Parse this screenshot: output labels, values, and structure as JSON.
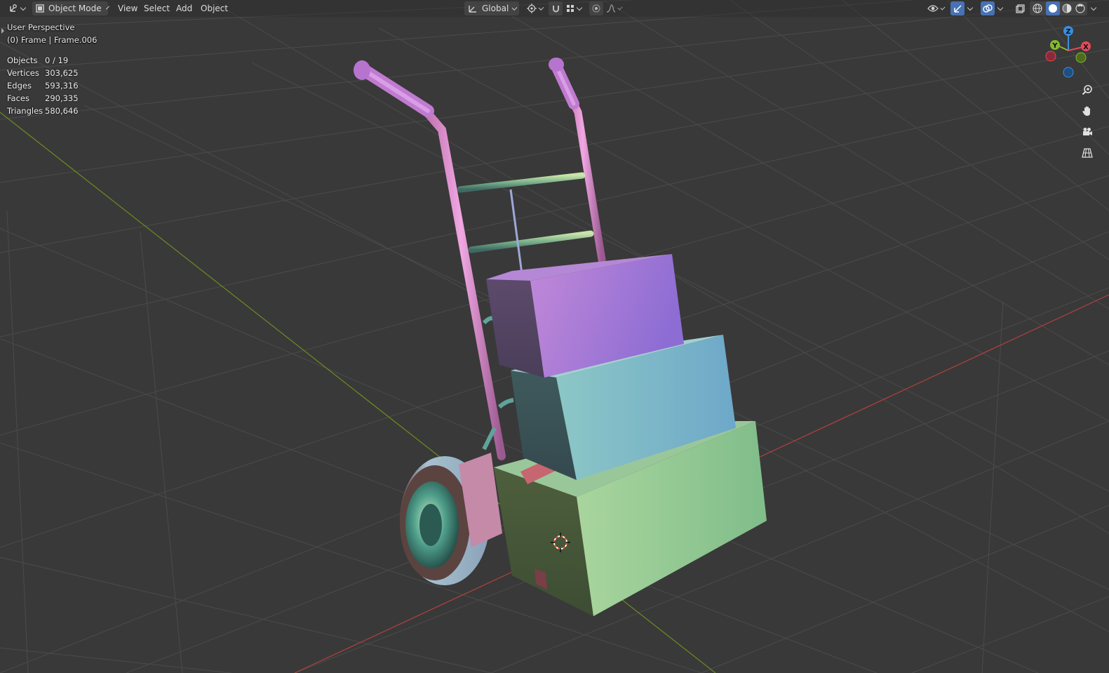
{
  "header": {
    "editor_type_icon": "editor-type-3d-viewport-icon",
    "mode": {
      "label": "Object Mode",
      "icon": "object-mode-icon"
    },
    "menus": [
      "View",
      "Select",
      "Add",
      "Object"
    ],
    "transform_orientation": {
      "label": "Global",
      "icon": "transform-orientation-icon"
    },
    "right_icons": [
      "pivot-point-icon",
      "snap-icon",
      "snap-element-icon",
      "proportional-edit-icon",
      "falloff-icon",
      "visibility-icon",
      "gizmo-icon",
      "overlay-icon",
      "xray-icon",
      "wireframe-shading-icon",
      "solid-shading-icon",
      "material-shading-icon",
      "rendered-shading-icon"
    ]
  },
  "viewport": {
    "view_name": "User Perspective",
    "frame_info": "(0) Frame | Frame.006",
    "stats": [
      {
        "label": "Objects",
        "value": "0 / 19"
      },
      {
        "label": "Vertices",
        "value": "303,625"
      },
      {
        "label": "Edges",
        "value": "593,316"
      },
      {
        "label": "Faces",
        "value": "290,335"
      },
      {
        "label": "Triangles",
        "value": "580,646"
      }
    ]
  },
  "gizmo": {
    "axes": [
      "Z",
      "Y",
      "X"
    ],
    "colors": {
      "x": "#e6485c",
      "y": "#84b831",
      "z": "#3a8fde"
    }
  },
  "nav_buttons": [
    "zoom-icon",
    "pan-hand-icon",
    "camera-view-icon",
    "ortho-grid-icon"
  ],
  "colors": {
    "background": "#393939",
    "grid": "#4b4b4b",
    "x_axis": "#b4403f",
    "y_axis": "#6b8e1f",
    "header": "#282828",
    "accent": "#4772b3"
  }
}
